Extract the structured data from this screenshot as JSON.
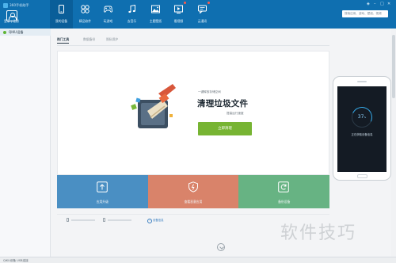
{
  "window": {
    "title": "360手机助手"
  },
  "account": {
    "login": "登录",
    "separator": "|",
    "register": "注册"
  },
  "tabs": [
    {
      "label": "我的设备",
      "icon": "phone-icon",
      "active": true
    },
    {
      "label": "精品软件",
      "icon": "apps-icon"
    },
    {
      "label": "玩游戏",
      "icon": "gamepad-icon"
    },
    {
      "label": "去音乐",
      "icon": "music-note-icon"
    },
    {
      "label": "主题壁纸",
      "icon": "image-icon"
    },
    {
      "label": "看视频",
      "icon": "video-icon"
    },
    {
      "label": "云通讯",
      "icon": "chat-icon"
    }
  ],
  "search": {
    "placeholder": "搜索应用、游戏、壁纸、视频"
  },
  "sidebar": {
    "device_label": "QIKU设备"
  },
  "subtabs": [
    "热门工具",
    "数据备份",
    "隐私保护"
  ],
  "clean_card": {
    "slogan": "一键释放存储空间",
    "title": "清理垃圾文件",
    "subtitle": "提高运行速度",
    "button": "立即清理"
  },
  "tiles": [
    {
      "label": "应用升级",
      "color": "#4a8fc3",
      "icon": "upgrade-icon"
    },
    {
      "label": "查看恶意应用",
      "color": "#d9836a",
      "icon": "shield-icon"
    },
    {
      "label": "备份设备",
      "color": "#67b383",
      "icon": "backup-icon"
    }
  ],
  "storage_row": {
    "info": "设备信息"
  },
  "phone_preview": {
    "percent": "37",
    "unit": "%",
    "message": "正在获取设备信息"
  },
  "statusbar": {
    "text": "QIKU设备  USB连接"
  },
  "watermark": "软件技巧",
  "colors": {
    "titlebar": "#0f6fb0",
    "accent_green": "#77b433"
  }
}
